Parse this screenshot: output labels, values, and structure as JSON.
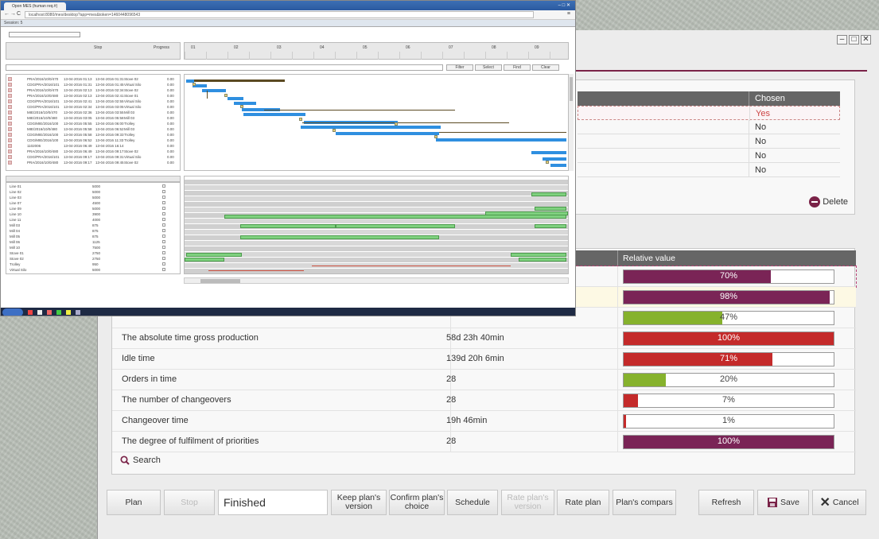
{
  "back": {
    "chosen_table": {
      "header": "Chosen",
      "values": [
        "Yes",
        "No",
        "No",
        "No",
        "No"
      ]
    },
    "delete_label": "Delete",
    "indicators": {
      "header_relative": "Relative value",
      "rows": [
        {
          "name": "",
          "value": "",
          "pct": "70%",
          "frac": 0.7,
          "color": "#7a2456"
        },
        {
          "name": "",
          "value": "",
          "pct": "98%",
          "frac": 0.98,
          "color": "#7a2456"
        },
        {
          "name": "",
          "value": "",
          "pct": "47%",
          "frac": 0.47,
          "color": "#86b22d"
        },
        {
          "name": "The absolute time gross production",
          "value": "58d 23h 40min",
          "pct": "100%",
          "frac": 1.0,
          "color": "#c42a2a"
        },
        {
          "name": "Idle time",
          "value": "139d 20h 6min",
          "pct": "71%",
          "frac": 0.71,
          "color": "#c42a2a"
        },
        {
          "name": "Orders in time",
          "value": "28",
          "pct": "20%",
          "frac": 0.2,
          "color": "#86b22d"
        },
        {
          "name": "The number of changeovers",
          "value": "28",
          "pct": "7%",
          "frac": 0.07,
          "color": "#c42a2a"
        },
        {
          "name": "Changeover time",
          "value": "19h 46min",
          "pct": "1%",
          "frac": 0.01,
          "color": "#c42a2a"
        },
        {
          "name": "The degree of fulfilment of priorities",
          "value": "28",
          "pct": "100%",
          "frac": 1.0,
          "color": "#7a2456"
        }
      ]
    },
    "search_label": "Search",
    "buttons": {
      "plan": "Plan",
      "stop": "Stop",
      "status": "Finished",
      "keep": "Keep plan's version",
      "confirm": "Confirm plan's choice",
      "schedule": "Schedule",
      "rate_version": "Rate plan's version",
      "rate_plan": "Rate plan",
      "compare": "Plan's compars",
      "refresh": "Refresh",
      "save": "Save",
      "cancel": "Cancel"
    }
  },
  "front": {
    "tab_title": "Opon MES (human req.#)",
    "url": "localhost:8080/mes/desktop?app=mes&token=1460448096543",
    "session": "Session: 5",
    "header_stop": "Stop",
    "header_progress": "Progress",
    "filter_buttons": [
      "Filter",
      "Select",
      "Find",
      "Clear"
    ],
    "orders": [
      {
        "id": "PRA/2016/10/0/470",
        "start": "13-04-2016 01:13",
        "end": "13-04-2016 01:31",
        "res": "Stove 02",
        "p": "0.00"
      },
      {
        "id": "CDG/PRA/2016/101",
        "start": "13-04-2016 01:31",
        "end": "13-04-2016 01:45",
        "res": "Virtual Silo",
        "p": "0.00"
      },
      {
        "id": "PRA/2016/10/0/470",
        "start": "13-04-2016 02:13",
        "end": "13-04-2016 02:34",
        "res": "Stove 02",
        "p": "0.00"
      },
      {
        "id": "PRA/2016/10/0/480",
        "start": "13-04-2016 02:13",
        "end": "13-04-2016 02:41",
        "res": "Stove 01",
        "p": "0.00"
      },
      {
        "id": "CDG/PRA/2016/101",
        "start": "13-04-2016 02:41",
        "end": "13-04-2016 02:55",
        "res": "Virtual Silo",
        "p": "0.00"
      },
      {
        "id": "CDG/PRA/2016/101",
        "start": "13-04-2016 02:34",
        "end": "13-04-2016 03:05",
        "res": "Virtual Silo",
        "p": "0.00"
      },
      {
        "id": "MIE/2016/10/0/470",
        "start": "13-04-2016 02:36",
        "end": "13-04-2016 03:55",
        "res": "Mill 03",
        "p": "0.00"
      },
      {
        "id": "MIE/2016/10/0/480",
        "start": "13-04-2016 03:05",
        "end": "13-04-2016 05:58",
        "res": "Mill 03",
        "p": "0.00"
      },
      {
        "id": "CDG/MIE/2016/100",
        "start": "13-04-2016 05:55",
        "end": "13-04-2016 06:00",
        "res": "Trolley",
        "p": "0.00"
      },
      {
        "id": "MIE/2016/10/0/480",
        "start": "13-04-2016 05:58",
        "end": "13-04-2016 06:52",
        "res": "Mill 03",
        "p": "0.00"
      },
      {
        "id": "CDG/MIE/2016/100",
        "start": "13-04-2016 05:58",
        "end": "13-04-2016 09:33",
        "res": "Trolley",
        "p": "0.00"
      },
      {
        "id": "CDG/MIE/2016/100",
        "start": "13-04-2016 06:52",
        "end": "13-04-2016 11:33",
        "res": "Trolley",
        "p": "0.00"
      },
      {
        "id": "1102006",
        "start": "13-04-2016 06:49",
        "end": "13-04-2016 16:14",
        "res": "",
        "p": "0.00"
      },
      {
        "id": "PRA/2016/10/0/480",
        "start": "13-04-2016 06:49",
        "end": "13-04-2016 09:17",
        "res": "Stove 02",
        "p": "0.00"
      },
      {
        "id": "CDG/PRA/2016/101",
        "start": "13-04-2016 09:17",
        "end": "13-04-2016 09:31",
        "res": "Virtual Silo",
        "p": "0.00"
      },
      {
        "id": "PRA/2016/10/0/480",
        "start": "13-04-2016 09:17",
        "end": "13-04-2016 09:45",
        "res": "Stove 02",
        "p": "0.00"
      }
    ],
    "resources": [
      {
        "name": "Line 01",
        "cap": "5000"
      },
      {
        "name": "Line 02",
        "cap": "5000"
      },
      {
        "name": "Line 03",
        "cap": "5000"
      },
      {
        "name": "Line 07",
        "cap": "4500"
      },
      {
        "name": "Line 09",
        "cap": "5000"
      },
      {
        "name": "Line 10",
        "cap": "3900"
      },
      {
        "name": "Line 11",
        "cap": "4000"
      },
      {
        "name": "Mill 03",
        "cap": "875"
      },
      {
        "name": "Mill 04",
        "cap": "875"
      },
      {
        "name": "Mill 05",
        "cap": "875"
      },
      {
        "name": "Mill 06",
        "cap": "1125"
      },
      {
        "name": "Mill 10",
        "cap": "7500"
      },
      {
        "name": "Stove 01",
        "cap": "2750"
      },
      {
        "name": "Stove 02",
        "cap": "2750"
      },
      {
        "name": "Trolley",
        "cap": "950"
      },
      {
        "name": "Virtual Silo",
        "cap": "5000"
      }
    ],
    "timeline": [
      "01",
      "02",
      "03",
      "04",
      "05",
      "06",
      "07",
      "08",
      "09"
    ]
  }
}
